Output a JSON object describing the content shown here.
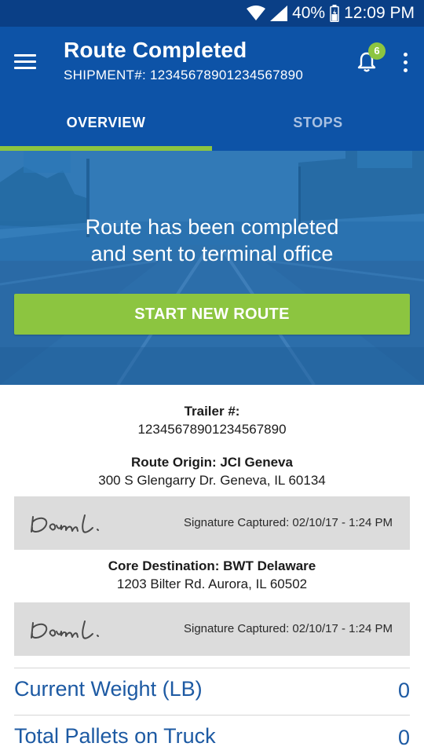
{
  "status_bar": {
    "battery": "40%",
    "time": "12:09 PM"
  },
  "header": {
    "title": "Route Completed",
    "subtitle": "SHIPMENT#: 12345678901234567890",
    "notification_count": "6"
  },
  "tabs": [
    {
      "label": "OVERVIEW",
      "active": true
    },
    {
      "label": "STOPS",
      "active": false
    }
  ],
  "hero": {
    "line1": "Route has been completed",
    "line2": "and sent to terminal office",
    "button_label": "START NEW ROUTE"
  },
  "trailer": {
    "label": "Trailer #:",
    "value": "12345678901234567890"
  },
  "origin": {
    "label": "Route Origin: JCI Geneva",
    "address": "300 S Glengarry Dr. Geneva, IL 60134",
    "signature_text": "Signature Captured: 02/10/17 - 1:24 PM"
  },
  "destination": {
    "label": "Core Destination: BWT Delaware",
    "address": "1203 Bilter Rd.  Aurora, IL 60502",
    "signature_text": "Signature Captured: 02/10/17 - 1:24 PM"
  },
  "stats": [
    {
      "label": "Current Weight (LB)",
      "value": "0"
    },
    {
      "label": "Total Pallets on Truck",
      "value": "0"
    }
  ],
  "colors": {
    "status_bar": "#0a3f86",
    "app_bar": "#0d53a7",
    "accent_green": "#8cc540",
    "stat_blue": "#1d5aa3",
    "signature_bg": "#dcdcdc"
  }
}
